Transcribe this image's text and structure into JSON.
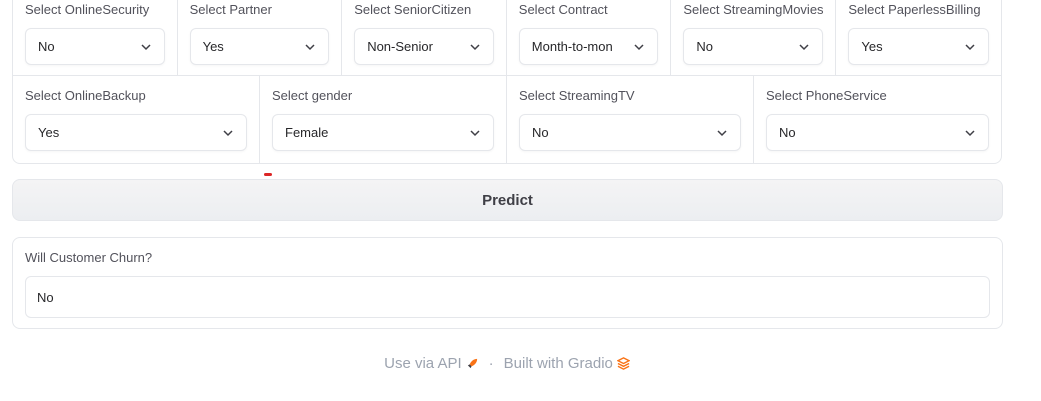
{
  "row1": [
    {
      "label": "Select OnlineSecurity",
      "value": "No"
    },
    {
      "label": "Select Partner",
      "value": "Yes"
    },
    {
      "label": "Select SeniorCitizen",
      "value": "Non-Senior"
    },
    {
      "label": "Select Contract",
      "value": "Month-to-mon"
    },
    {
      "label": "Select StreamingMovies",
      "value": "No"
    },
    {
      "label": "Select PaperlessBilling",
      "value": "Yes"
    }
  ],
  "row2": [
    {
      "label": "Select OnlineBackup",
      "value": "Yes"
    },
    {
      "label": "Select gender",
      "value": "Female"
    },
    {
      "label": "Select StreamingTV",
      "value": "No"
    },
    {
      "label": "Select PhoneService",
      "value": "No"
    }
  ],
  "predict_label": "Predict",
  "output": {
    "label": "Will Customer Churn?",
    "value": "No"
  },
  "footer": {
    "api_link": "Use via API",
    "separator": "·",
    "built_with": "Built with Gradio"
  },
  "colors": {
    "accent": "#f97316",
    "border": "#e5e7eb",
    "muted": "#9ca3af"
  },
  "icons": {
    "dropdown": "chevron-down-icon",
    "api": "rocket-icon",
    "gradio": "gradio-logo-icon"
  }
}
